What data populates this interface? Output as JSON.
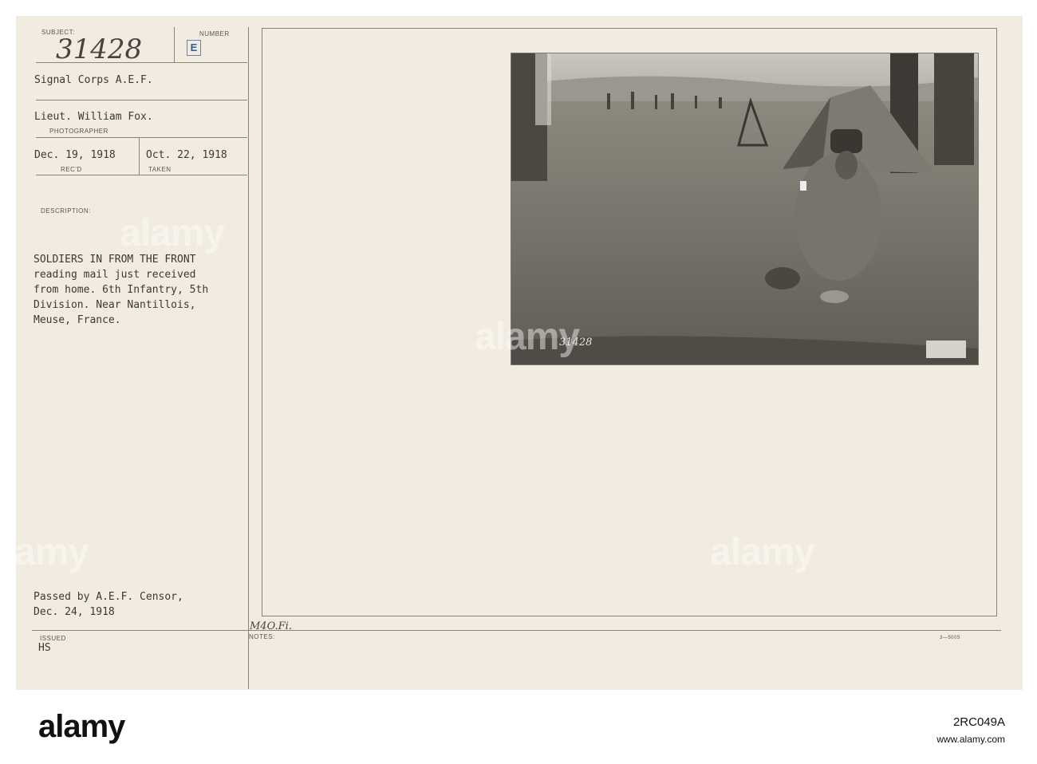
{
  "card": {
    "subject_label": "SUBJECT:",
    "subject_number": "31428",
    "number_label": "NUMBER",
    "number_stamp": "E",
    "unit": "Signal Corps A.E.F.",
    "photographer_name": "Lieut. William Fox.",
    "photographer_label": "PHOTOGRAPHER",
    "received_date": "Dec. 19, 1918",
    "received_label": "REC'D",
    "taken_date": "Oct. 22, 1918",
    "taken_label": "TAKEN",
    "description_label": "DESCRIPTION:",
    "description_lines": [
      "SOLDIERS IN FROM THE FRONT",
      "reading mail just received",
      "from home. 6th Infantry, 5th",
      "Division. Near Nantillois,",
      "Meuse, France."
    ],
    "censor_line1": "Passed by A.E.F. Censor,",
    "censor_line2": "Dec. 24, 1918",
    "issued_label": "ISSUED",
    "issued_value": "HS",
    "notes_label": "NOTES:",
    "notes_handwriting": "M4O.Fi.",
    "form_number": "3—5005",
    "photo_number": "31428"
  },
  "watermark_text": "alamy",
  "footer": {
    "logo": "alamy",
    "stock_id": "2RC049A",
    "image_id_line": "www.alamy.com"
  }
}
